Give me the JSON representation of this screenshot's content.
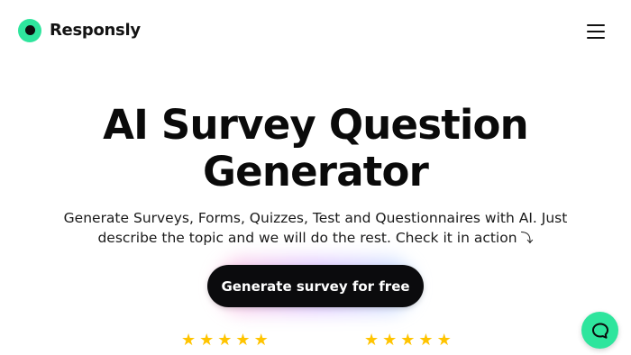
{
  "brand": {
    "name": "Responsly",
    "accent_color": "#2ee59d"
  },
  "header": {
    "menu_icon": "hamburger-menu-icon"
  },
  "hero": {
    "title": "AI Survey Question Generator",
    "subtitle": "Generate Surveys, Forms, Quizzes, Test and Questionnaires with AI. Just describe the topic and we will do the rest. Check it in action",
    "arrow_glyph": "⤵"
  },
  "cta": {
    "label": "Generate survey for free"
  },
  "ratings": [
    {
      "stars": 5,
      "star_color": "#ffc400"
    },
    {
      "stars": 5,
      "star_color": "#ffc400"
    }
  ],
  "chat": {
    "icon": "chat-bubble-icon"
  }
}
